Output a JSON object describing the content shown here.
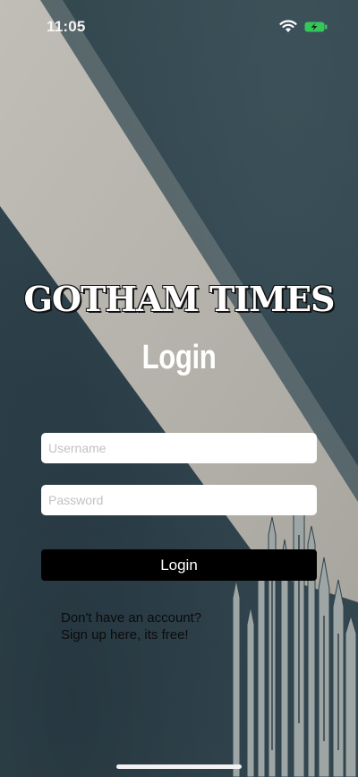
{
  "status_bar": {
    "time": "11:05",
    "wifi_icon": "wifi-icon",
    "battery_icon": "battery-charging-icon",
    "battery_color": "#34c759"
  },
  "header": {
    "title": "GOTHAM TIMES",
    "subtitle": "Login"
  },
  "form": {
    "username_placeholder": "Username",
    "username_value": "",
    "password_placeholder": "Password",
    "password_value": "",
    "login_label": "Login"
  },
  "signup": {
    "line1": "Don't have an account?",
    "line2": "Sign up here, its free!"
  },
  "colors": {
    "background": "#324550",
    "beam": "#bfbcb3",
    "button": "#000000"
  }
}
